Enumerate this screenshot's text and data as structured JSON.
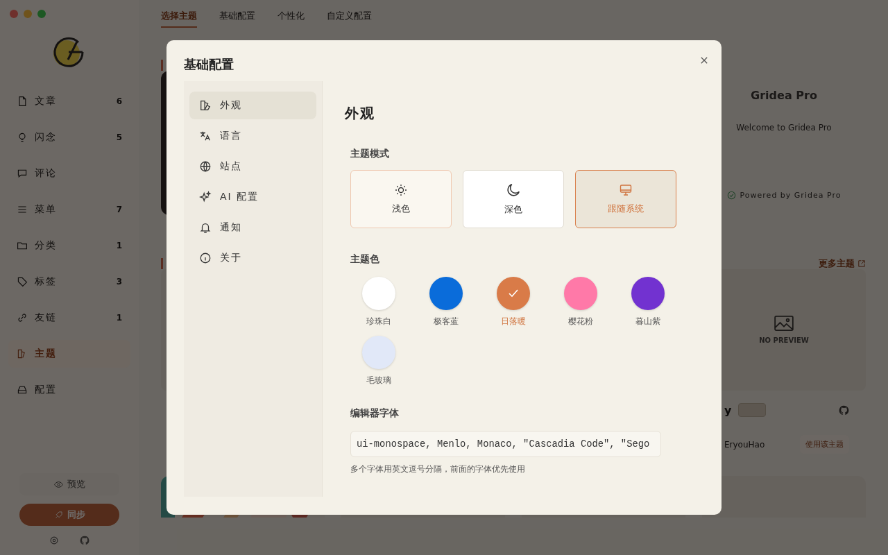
{
  "sidebar": {
    "items": [
      {
        "label": "文章",
        "count": "6",
        "kind": "doc",
        "selected": false
      },
      {
        "label": "闪念",
        "count": "5",
        "kind": "bulb",
        "selected": false
      },
      {
        "label": "评论",
        "kind": "chat",
        "selected": false
      },
      {
        "label": "菜单",
        "count": "7",
        "kind": "menu",
        "selected": false
      },
      {
        "label": "分类",
        "count": "1",
        "kind": "folder",
        "selected": false
      },
      {
        "label": "标签",
        "count": "3",
        "kind": "tag",
        "selected": false
      },
      {
        "label": "友链",
        "count": "1",
        "kind": "link",
        "selected": false
      },
      {
        "label": "主题",
        "kind": "theme",
        "selected": true
      },
      {
        "label": "配置",
        "kind": "drive",
        "selected": false
      }
    ],
    "preview_button": "预览",
    "sync_button": "同步"
  },
  "top_tabs": [
    {
      "label": "选择主题",
      "selected": true
    },
    {
      "label": "基础配置",
      "selected": false
    },
    {
      "label": "个性化",
      "selected": false
    },
    {
      "label": "自定义配置",
      "selected": false
    }
  ],
  "theme_card": {
    "title": "Gridea Pro",
    "subtitle": "Welcome to Gridea Pro",
    "footer": "Powered by Gridea Pro"
  },
  "more_themes": "更多主题",
  "theme_item": {
    "preview": "NO PREVIEW",
    "name": "y",
    "author": "EryouHao",
    "use_button": "使用该主题"
  },
  "dialog": {
    "title": "基础配置",
    "nav": [
      {
        "label": "外观",
        "kind": "palette",
        "selected": true
      },
      {
        "label": "语言",
        "kind": "translate",
        "selected": false
      },
      {
        "label": "站点",
        "kind": "globe",
        "selected": false
      },
      {
        "label": "AI 配置",
        "kind": "sparkle",
        "selected": false
      },
      {
        "label": "通知",
        "kind": "bell",
        "selected": false
      },
      {
        "label": "关于",
        "kind": "info",
        "selected": false
      }
    ],
    "section_title": "外观",
    "theme_mode": {
      "label": "主题模式",
      "options": [
        {
          "label": "浅色",
          "kind": "light",
          "selected": false
        },
        {
          "label": "深色",
          "kind": "dark",
          "selected": false
        },
        {
          "label": "跟随系统",
          "kind": "system",
          "selected": true
        }
      ]
    },
    "theme_color": {
      "label": "主题色",
      "swatches": [
        {
          "label": "珍珠白",
          "color": "#ffffff",
          "selected": false
        },
        {
          "label": "极客蓝",
          "color": "#0a6cda",
          "selected": false
        },
        {
          "label": "日落暖",
          "color": "#d97b48",
          "selected": true
        },
        {
          "label": "樱花粉",
          "color": "#ff79a8",
          "selected": false
        },
        {
          "label": "暮山紫",
          "color": "#7232d0",
          "selected": false
        },
        {
          "label": "毛玻璃",
          "color": "#e1e8f8",
          "selected": false
        }
      ]
    },
    "editor_font": {
      "label": "编辑器字体",
      "value": "ui-monospace, Menlo, Monaco, \"Cascadia Code\", \"Sego",
      "hint": "多个字体用英文逗号分隔，前面的字体优先使用"
    }
  }
}
